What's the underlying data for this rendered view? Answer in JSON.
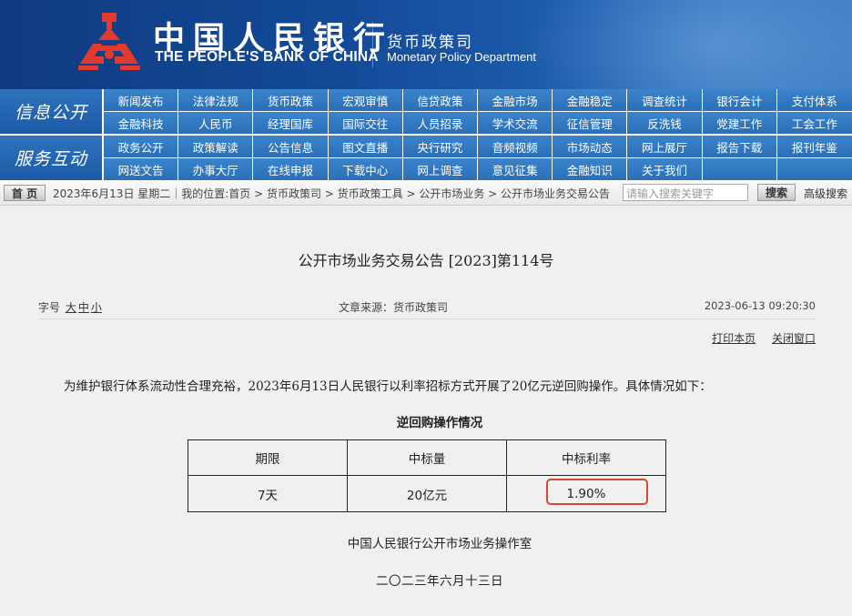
{
  "header": {
    "name_cn": "中国人民银行",
    "name_en": "THE PEOPLE'S BANK OF CHINA",
    "dept_cn": "货币政策司",
    "dept_en": "Monetary Policy Department",
    "logo_icon": "pboc-emblem-icon",
    "colors": {
      "banner": "#134a98",
      "nav": "#2a6fb8",
      "highlight": "#d9453b"
    }
  },
  "nav": {
    "section1": {
      "label": "信息公开",
      "items": [
        "新闻发布",
        "法律法规",
        "货币政策",
        "宏观审慎",
        "信贷政策",
        "金融市场",
        "金融稳定",
        "调查统计",
        "银行会计",
        "支付体系",
        "金融科技",
        "人民币",
        "经理国库",
        "国际交往",
        "人员招录",
        "学术交流",
        "征信管理",
        "反洗钱",
        "党建工作",
        "工会工作"
      ]
    },
    "section2": {
      "label": "服务互动",
      "items": [
        "政务公开",
        "政策解读",
        "公告信息",
        "图文直播",
        "央行研究",
        "音频视频",
        "市场动态",
        "网上展厅",
        "报告下载",
        "报刊年鉴",
        "网送文告",
        "办事大厅",
        "在线申报",
        "下载中心",
        "网上调查",
        "意见征集",
        "金融知识",
        "关于我们",
        "",
        ""
      ]
    }
  },
  "breadcrumb": {
    "home": "首 页",
    "text": "2023年6月13日 星期二｜我的位置:首页 > 货币政策司 > 货币政策工具 > 公开市场业务 > 公开市场业务交易公告",
    "search_placeholder": "请输入搜索关键字",
    "search_button": "搜索",
    "advanced": "高级搜索"
  },
  "article": {
    "title": "公开市场业务交易公告 [2023]第114号",
    "font_size_label": "字号",
    "font_sizes": [
      "大",
      "中",
      "小"
    ],
    "source": "文章来源：货币政策司",
    "datetime": "2023-06-13 09:20:30",
    "print": "打印本页",
    "close": "关闭窗口",
    "paragraph": "为维护银行体系流动性合理充裕，2023年6月13日人民银行以利率招标方式开展了20亿元逆回购操作。具体情况如下：",
    "table_caption": "逆回购操作情况",
    "table": {
      "headers": [
        "期限",
        "中标量",
        "中标利率"
      ],
      "rows": [
        [
          "7天",
          "20亿元",
          "1.90%"
        ]
      ]
    },
    "issuer": "中国人民银行公开市场业务操作室",
    "issue_date": "二〇二三年六月十三日"
  }
}
